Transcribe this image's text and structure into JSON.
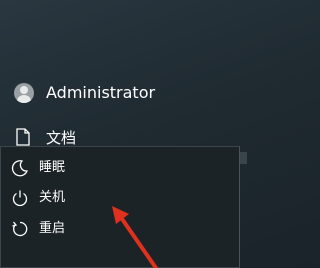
{
  "user": {
    "name": "Administrator",
    "avatar_icon": "user-avatar-icon"
  },
  "documents": {
    "label": "文档",
    "icon": "document-icon"
  },
  "power_menu": {
    "items": [
      {
        "label": "睡眠",
        "icon": "moon-icon"
      },
      {
        "label": "关机",
        "icon": "power-icon"
      },
      {
        "label": "重启",
        "icon": "restart-icon"
      }
    ]
  },
  "annotation": {
    "arrow_color": "#e0301e"
  }
}
